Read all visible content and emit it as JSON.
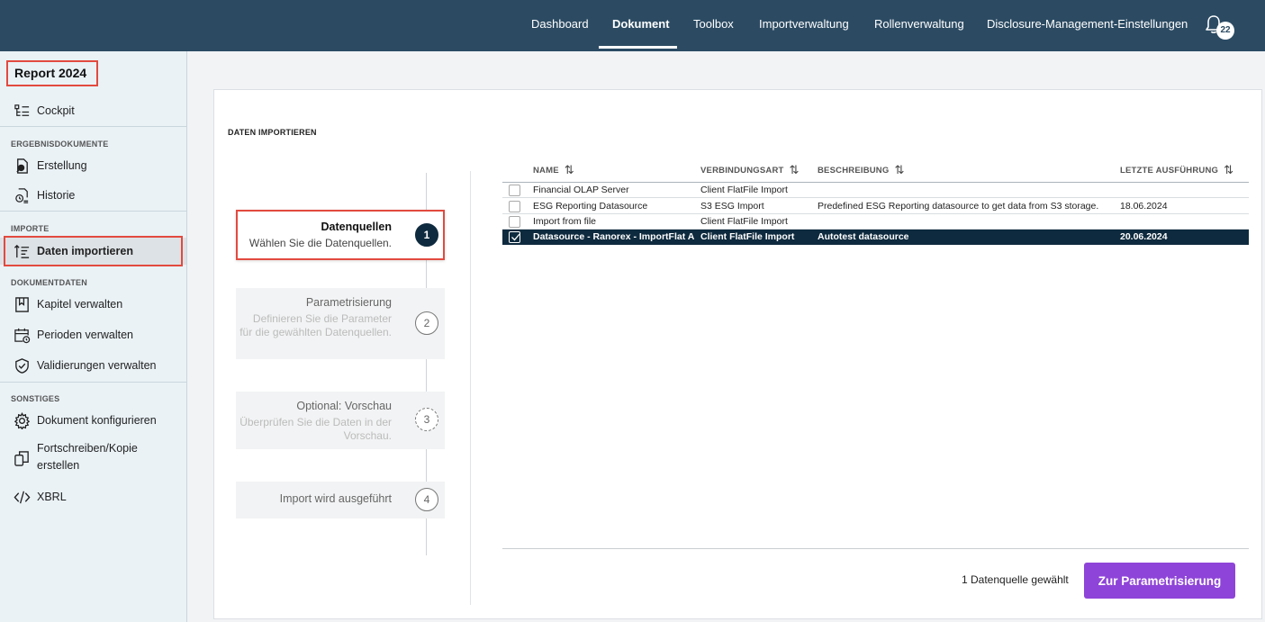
{
  "topnav": {
    "items": [
      {
        "label": "Dashboard"
      },
      {
        "label": "Dokument"
      },
      {
        "label": "Toolbox"
      },
      {
        "label": "Importverwaltung"
      },
      {
        "label": "Rollenverwaltung"
      },
      {
        "label": "Disclosure-Management-Einstellungen"
      }
    ],
    "active": "Dokument",
    "notifications_count": "22"
  },
  "sidebar": {
    "report_title": "Report 2024",
    "cockpit": "Cockpit",
    "sections": {
      "ergebnis": "ERGEBNISDOKUMENTE",
      "importe": "IMPORTE",
      "dokumentdaten": "DOKUMENTDATEN",
      "sonstiges": "SONSTIGES"
    },
    "items": {
      "erstellung": "Erstellung",
      "historie": "Historie",
      "daten_importieren": "Daten importieren",
      "kapitel": "Kapitel verwalten",
      "perioden": "Perioden verwalten",
      "validierungen": "Validierungen verwalten",
      "dokument_konfigurieren": "Dokument konfigurieren",
      "fortschreiben_1": "Fortschreiben/Kopie",
      "fortschreiben_2": "erstellen",
      "xbrl": "XBRL"
    },
    "active_item": "Daten importieren"
  },
  "main": {
    "title": "DATEN IMPORTIEREN",
    "steps": [
      {
        "number": "1",
        "title": "Datenquellen",
        "description": "Wählen Sie die Datenquellen."
      },
      {
        "number": "2",
        "title": "Parametrisierung",
        "description": "Definieren Sie die Parameter für die gewählten Datenquellen."
      },
      {
        "number": "3",
        "title": "Optional: Vorschau",
        "description": "Überprüfen Sie die Daten in der Vorschau."
      },
      {
        "number": "4",
        "title": "Import wird ausgeführt",
        "description": ""
      }
    ],
    "table": {
      "headers": {
        "name": "NAME",
        "verbindungsart": "VERBINDUNGSART",
        "beschreibung": "BESCHREIBUNG",
        "letzte": "LETZTE AUSFÜHRUNG"
      },
      "rows": [
        {
          "name": "Financial OLAP Server",
          "verbindungsart": "Client FlatFile Import",
          "beschreibung": "",
          "letzte": "",
          "selected": false
        },
        {
          "name": "ESG Reporting Datasource",
          "verbindungsart": "S3 ESG Import",
          "beschreibung": "Predefined ESG Reporting datasource to get data from S3 storage.",
          "letzte": "18.06.2024",
          "selected": false
        },
        {
          "name": "Import from file",
          "verbindungsart": "Client FlatFile Import",
          "beschreibung": "",
          "letzte": "",
          "selected": false
        },
        {
          "name": "Datasource - Ranorex - ImportFlat A",
          "verbindungsart": "Client FlatFile Import",
          "beschreibung": "Autotest datasource",
          "letzte": "20.06.2024",
          "selected": true
        }
      ]
    },
    "selection_count": "1 Datenquelle gewählt",
    "next_button": "Zur Parametrisierung"
  },
  "colors": {
    "topbar": "#2c4b63",
    "sidebar": "#eaf2f6",
    "selected_row": "#0e2a3e",
    "primary_button": "#8e44d8",
    "highlight": "#e24a3f"
  }
}
